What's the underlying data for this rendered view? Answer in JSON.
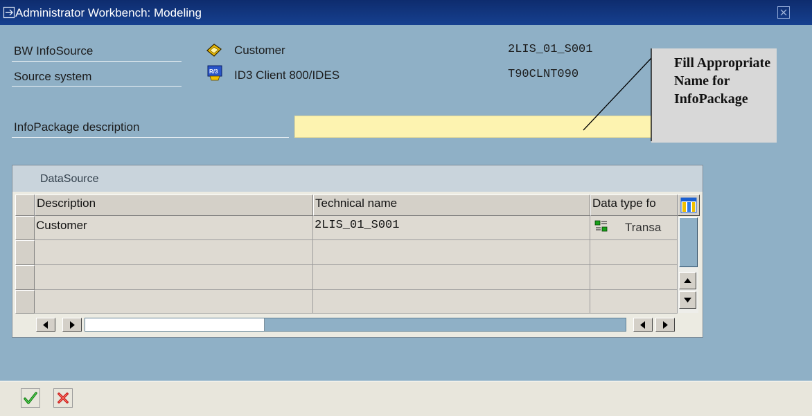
{
  "window": {
    "title": "Administrator Workbench: Modeling"
  },
  "header": {
    "infosource_label": "BW InfoSource",
    "infosource_value": "Customer",
    "infosource_tech": "2LIS_01_S001",
    "source_system_label": "Source system",
    "source_system_value": "ID3 Client 800/IDES",
    "source_system_tech": "T90CLNT090",
    "infopackage_label": "InfoPackage description",
    "infopackage_value": ""
  },
  "callout": {
    "text": "Fill Appropriate Name for InfoPackage"
  },
  "table": {
    "title": "DataSource",
    "columns": [
      "Description",
      "Technical name",
      "Data type fo"
    ],
    "rows": [
      {
        "description": "Customer",
        "technical_name": "2LIS_01_S001",
        "data_type": "Transa"
      },
      {
        "description": "",
        "technical_name": "",
        "data_type": ""
      },
      {
        "description": "",
        "technical_name": "",
        "data_type": ""
      },
      {
        "description": "",
        "technical_name": "",
        "data_type": ""
      }
    ]
  },
  "icons": {
    "title": "window-icon",
    "infosource": "infosource-icon",
    "source_system": "r3-system-icon",
    "data_type": "transaction-data-icon",
    "column_settings": "column-settings-icon",
    "confirm": "check-icon",
    "cancel": "cancel-icon"
  },
  "colors": {
    "title_bar": "#0e2c6e",
    "background": "#8fb0c6",
    "input_required": "#fdf3b0",
    "callout": "#d8d8d8"
  }
}
